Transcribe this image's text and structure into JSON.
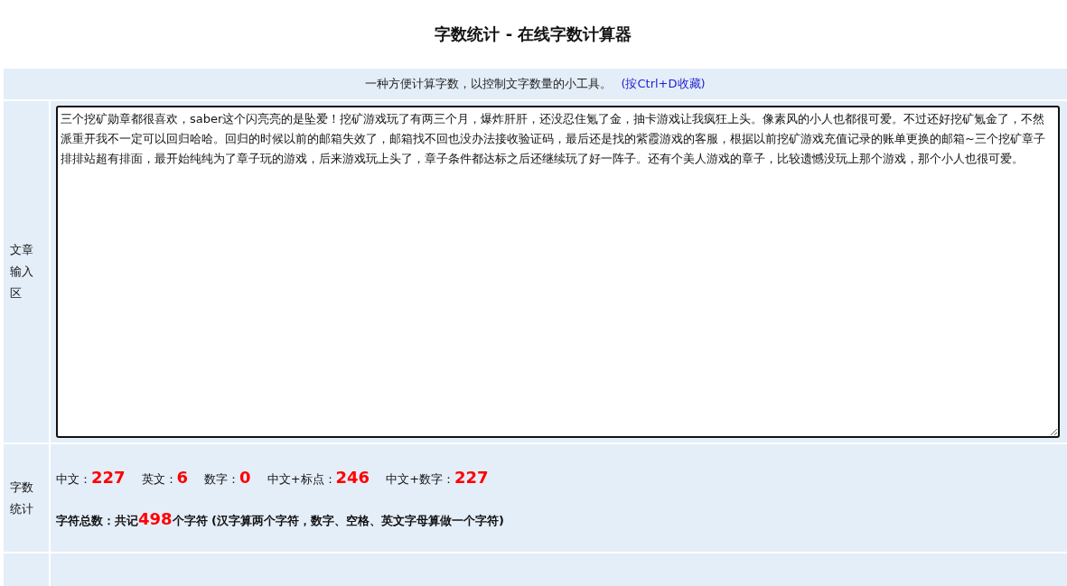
{
  "title": "字数统计 - 在线字数计算器",
  "intro": {
    "text": "一种方便计算字数，以控制文字数量的小工具。",
    "link": "(按Ctrl+D收藏)"
  },
  "input": {
    "label": "文章输入区",
    "value": "三个挖矿勋章都很喜欢，saber这个闪亮亮的是坠爱！挖矿游戏玩了有两三个月，爆炸肝肝，还没忍住氪了金，抽卡游戏让我疯狂上头。像素风的小人也都很可爱。不过还好挖矿氪金了，不然派重开我不一定可以回归哈哈。回归的时候以前的邮箱失效了，邮箱找不回也没办法接收验证码，最后还是找的紫霞游戏的客服，根据以前挖矿游戏充值记录的账单更换的邮箱~三个挖矿章子排排站超有排面，最开始纯纯为了章子玩的游戏，后来游戏玩上头了，章子条件都达标之后还继续玩了好一阵子。还有个美人游戏的章子，比较遗憾没玩上那个游戏，那个小人也很可爱。"
  },
  "stats": {
    "label": "字数统计",
    "counts": [
      {
        "label": "中文：",
        "value": "227"
      },
      {
        "label": "英文：",
        "value": "6"
      },
      {
        "label": "数字：",
        "value": "0"
      },
      {
        "label": "中文+标点：",
        "value": "246"
      },
      {
        "label": "中文+数字：",
        "value": "227"
      }
    ],
    "total": {
      "prefix": "字符总数：共记",
      "value": "498",
      "suffix": "个字符 (汉字算两个字符，数字、空格、英文字母算做一个字符)"
    }
  }
}
